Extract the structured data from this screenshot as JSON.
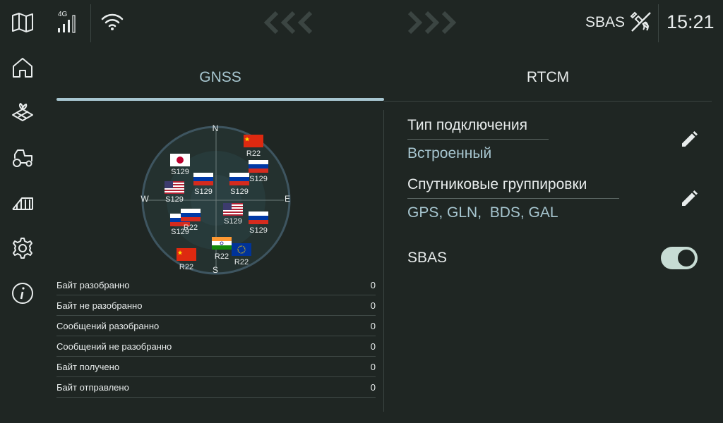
{
  "status_bar": {
    "network": "4G",
    "sbas": "SBAS",
    "time": "15:21"
  },
  "sidebar": {
    "items": [
      {
        "icon": "map-icon"
      },
      {
        "icon": "home-icon"
      },
      {
        "icon": "field-icon"
      },
      {
        "icon": "tractor-icon"
      },
      {
        "icon": "implement-icon"
      },
      {
        "icon": "gear-icon"
      },
      {
        "icon": "info-icon"
      }
    ]
  },
  "tabs": [
    {
      "label": "GNSS",
      "active": true
    },
    {
      "label": "RTCM",
      "active": false
    }
  ],
  "skyplot": {
    "directions": {
      "n": "N",
      "e": "E",
      "s": "S",
      "w": "W"
    },
    "satellites": [
      {
        "flag": "cn",
        "label": "R22"
      },
      {
        "flag": "jp",
        "label": "S129"
      },
      {
        "flag": "ru",
        "label": "S129"
      },
      {
        "flag": "ru",
        "label": "S129"
      },
      {
        "flag": "ru",
        "label": "S129"
      },
      {
        "flag": "us",
        "label": "S129"
      },
      {
        "flag": "ru",
        "label": "S129"
      },
      {
        "flag": "ru",
        "label": "R22"
      },
      {
        "flag": "us",
        "label": "S129"
      },
      {
        "flag": "ru",
        "label": "S129"
      },
      {
        "flag": "in",
        "label": "R22"
      },
      {
        "flag": "eu",
        "label": "R22"
      },
      {
        "flag": "cn",
        "label": "R22"
      }
    ]
  },
  "stats": [
    {
      "label": "Байт разобранно",
      "value": "0"
    },
    {
      "label": "Байт не разобранно",
      "value": "0"
    },
    {
      "label": "Сообщений разобранно",
      "value": "0"
    },
    {
      "label": "Сообщений не разобранно",
      "value": "0"
    },
    {
      "label": "Байт получено",
      "value": "0"
    },
    {
      "label": "Байт отправлено",
      "value": "0"
    }
  ],
  "settings": {
    "connection_type": {
      "label": "Тип подключения",
      "value": "Встроенный"
    },
    "constellations": {
      "label": "Спутниковые группировки",
      "value": "GPS, GLN,  BDS, GAL"
    },
    "sbas": {
      "label": "SBAS",
      "enabled": true
    }
  },
  "colors": {
    "background": "#1f2623",
    "accent": "#a7c6d0",
    "toggle_on": "#c7dcd4"
  }
}
